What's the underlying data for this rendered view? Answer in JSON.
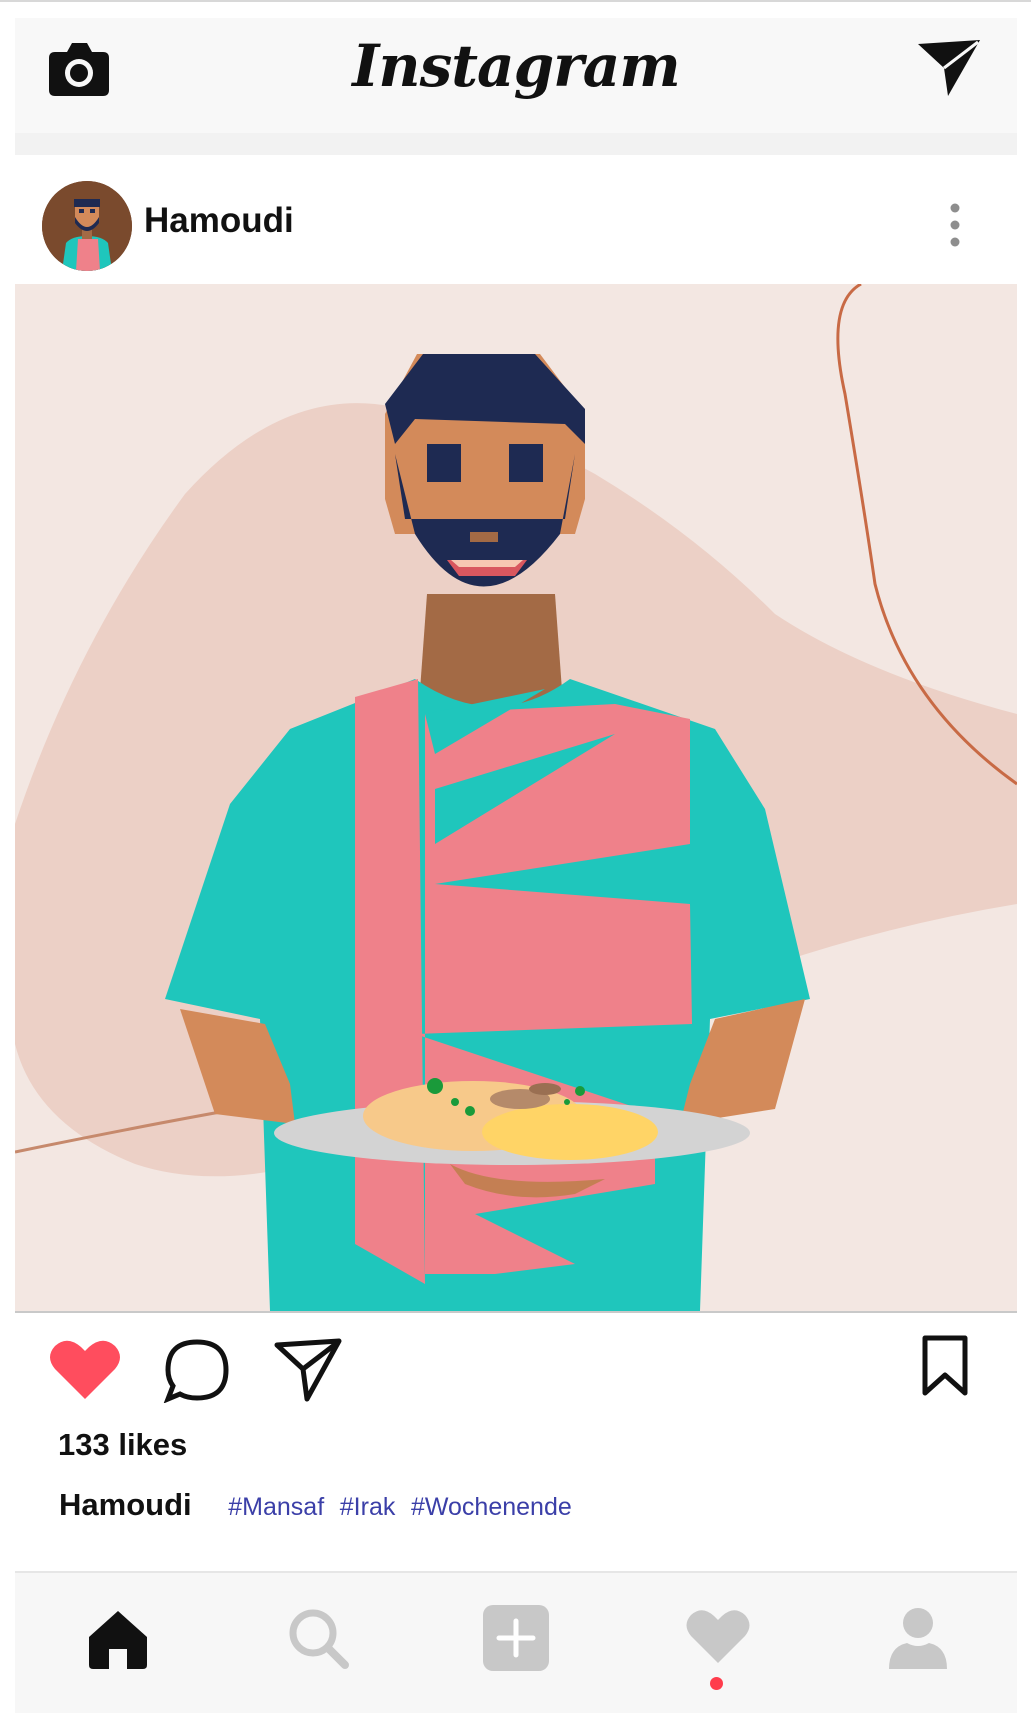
{
  "app": {
    "logo_text": "Instagram",
    "colors": {
      "like_red": "#ff4d5e",
      "hashtag_blue": "#3b3fa8",
      "notification_dot": "#ff3c4c",
      "inactive_icon": "#c8c8c8"
    }
  },
  "topbar": {
    "left_icon": "camera-icon",
    "right_icon": "send-icon"
  },
  "post": {
    "username": "Hamoudi",
    "likes_text": "133 likes",
    "caption": {
      "username": "Hamoudi",
      "hashtags": [
        "#Mansaf",
        "#Irak",
        "#Wochenende"
      ]
    },
    "liked": true,
    "actions": [
      "heart-icon",
      "comment-icon",
      "share-icon",
      "bookmark-icon"
    ]
  },
  "bottom_nav": {
    "items": [
      {
        "icon": "home-icon",
        "active": true
      },
      {
        "icon": "search-icon",
        "active": false
      },
      {
        "icon": "add-post-icon",
        "active": false
      },
      {
        "icon": "activity-heart-icon",
        "active": false,
        "has_notification": true
      },
      {
        "icon": "profile-icon",
        "active": false
      }
    ]
  }
}
